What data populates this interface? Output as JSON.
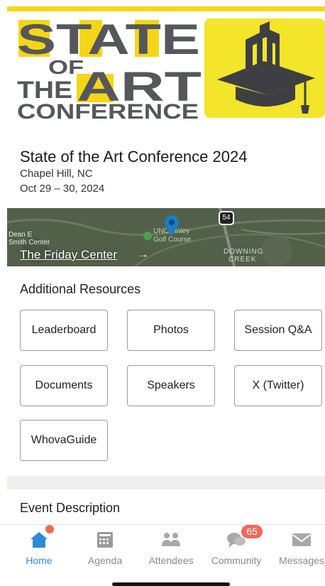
{
  "banner": {
    "logo_line1": "STATE",
    "logo_line2": "OF",
    "logo_line3a": "THE",
    "logo_line3b": "ART",
    "logo_line4": "CONFERENCE",
    "accent_color": "#f4d617",
    "logo_tile_icon": "graduation-cap-building-icon"
  },
  "event": {
    "title": "State of the Art Conference 2024",
    "location": "Chapel Hill, NC",
    "dates": "Oct 29 – 30, 2024"
  },
  "map": {
    "link_text": "The Friday Center",
    "arrow": "→",
    "labels": {
      "dean": "Dean E",
      "smith": "Smith Center",
      "unc": "UNC Finley",
      "golf": "Golf Course",
      "downing": "DOWNING",
      "creek": "CREEK",
      "route": "54"
    }
  },
  "resources": {
    "heading": "Additional Resources",
    "buttons": [
      "Leaderboard",
      "Photos",
      "Session Q&A",
      "Documents",
      "Speakers",
      "X (Twitter)",
      "WhovaGuide"
    ]
  },
  "description": {
    "heading": "Event Description"
  },
  "tabs": [
    {
      "label": "Home",
      "icon": "home-icon",
      "active": true
    },
    {
      "label": "Agenda",
      "icon": "calendar-icon",
      "active": false
    },
    {
      "label": "Attendees",
      "icon": "attendees-icon",
      "active": false
    },
    {
      "label": "Community",
      "icon": "community-icon",
      "active": false
    },
    {
      "label": "Messages",
      "icon": "messages-icon",
      "active": false
    }
  ],
  "badges": {
    "community_count": "65"
  },
  "colors": {
    "active_tab": "#2d8ad8",
    "badge": "#f06a5a",
    "inactive_tab": "#8a8a8a"
  }
}
